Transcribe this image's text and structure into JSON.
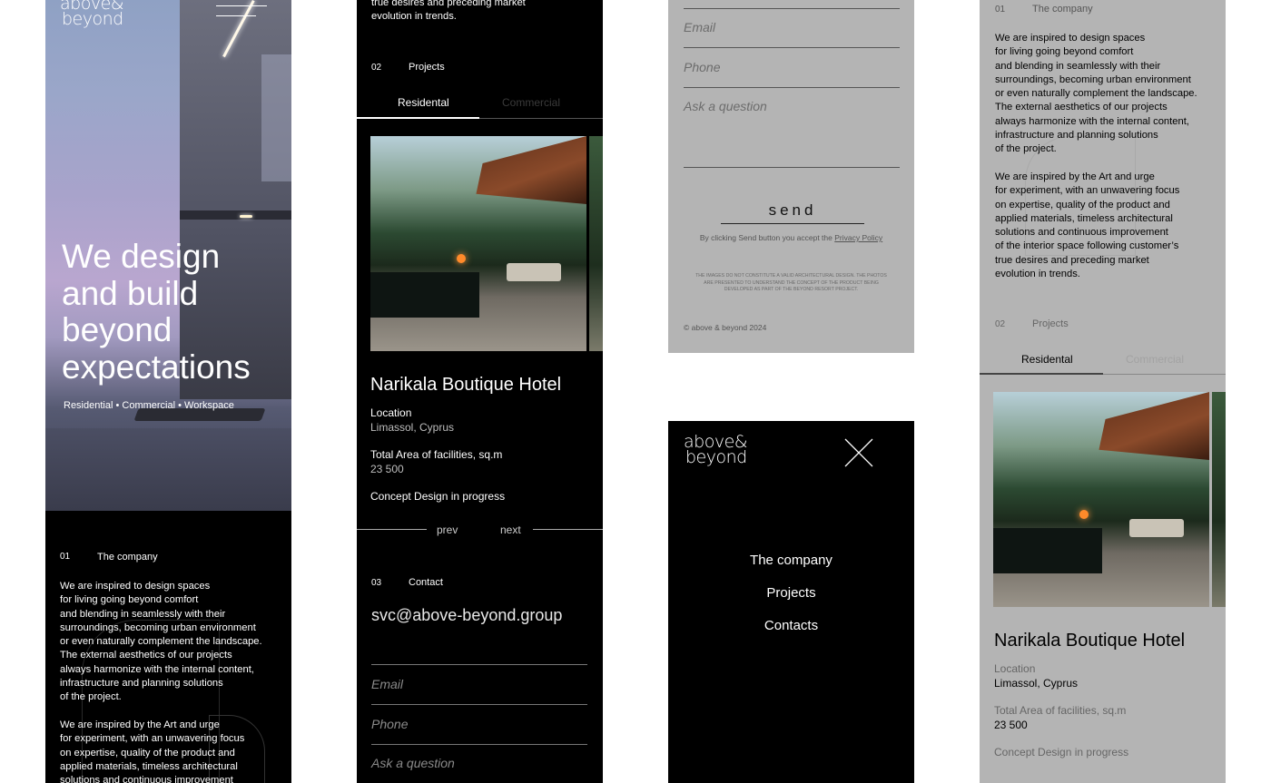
{
  "logo": {
    "line1": "above&",
    "line2": "beyond"
  },
  "hero": {
    "headline": "We design\nand build\nbeyond\nexpectations",
    "tags": "Residential • Commercial • Workspace"
  },
  "company": {
    "num": "01",
    "title": "The company",
    "p1": "We are inspired to design spaces\nfor living going beyond comfort\nand blending in seamlessly with their\nsurroundings, becoming urban environment\nor even naturally complement the landscape.\nThe external aesthetics of our projects\nalways harmonize with the internal content,\ninfrastructure and planning solutions\nof the project.",
    "p2": "We are inspired by the Art and urge\nfor experiment, with an unwavering focus\non expertise, quality of the product and\napplied materials, timeless architectural\nsolutions and continuous improvement\nof the interior space following customer’s\ntrue desires and preceding market\nevolution in trends.",
    "p2_partial_col1": "We are inspired by the Art and urge\nfor experiment, with an unwavering focus\non expertise, quality of the product and\napplied materials, timeless architectural\nsolutions and continuous improvement",
    "p2_tail": "true desires and preceding market\nevolution in trends."
  },
  "projects": {
    "num": "02",
    "title": "Projects",
    "tabs": [
      "Residental",
      "Commercial"
    ],
    "hotel_name": "Narikala Boutique Hotel",
    "location_label": "Location",
    "location_value": "Limassol, Cyprus",
    "area_label": "Total Area of facilities, sq.m",
    "area_value": "23 500",
    "status": "Concept Design in progress",
    "prev": "prev",
    "next": "next"
  },
  "contact": {
    "num": "03",
    "title": "Contact",
    "email": "svc@above-beyond.group",
    "placeholders": {
      "email": "Email",
      "phone": "Phone",
      "question": "Ask a question"
    },
    "send": "send",
    "consent_text": "By clicking Send button you accept the ",
    "privacy_link": "Privacy Policy",
    "disclaimer": "THE IMAGES DO NOT CONSTITUTE A VALID ARCHITECTURAL DESIGN. THE PHOTOS\nARE PRESENTED TO UNDERSTAND THE CONCEPT OF THE PRODUCT BEING\nDEVELOPED AS PART OF THE BEYOND RESORT PROJECT.",
    "copyright": "© above & beyond 2024"
  },
  "menu": {
    "items": [
      "The company",
      "Projects",
      "Contacts"
    ]
  },
  "colors": {
    "black": "#000000",
    "grey_panel": "#b4b4b4",
    "white": "#ffffff"
  },
  "icons": [
    "hamburger-icon",
    "close-icon"
  ]
}
